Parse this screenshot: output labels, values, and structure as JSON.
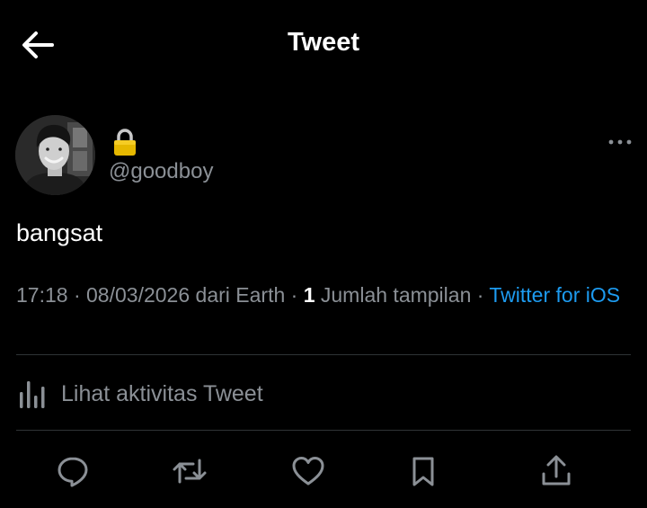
{
  "header": {
    "title": "Tweet",
    "back_icon": "arrow-left-icon"
  },
  "author": {
    "protected_icon": "lock-icon",
    "handle": "@goodboy",
    "more_icon": "more-horizontal-icon"
  },
  "tweet": {
    "text": "bangsat",
    "time": "17:18",
    "separator": " · ",
    "date": "08/03/2026",
    "location": " dari Earth",
    "views_count": "1",
    "views_label": " Jumlah tampilan",
    "source": "Twitter for iOS"
  },
  "activity": {
    "icon": "bar-chart-icon",
    "label": "Lihat aktivitas Tweet"
  },
  "actions": [
    {
      "icon": "reply-icon"
    },
    {
      "icon": "retweet-icon"
    },
    {
      "icon": "like-icon"
    },
    {
      "icon": "bookmark-icon"
    },
    {
      "icon": "share-icon"
    }
  ],
  "colors": {
    "background": "#000000",
    "text_primary": "#ffffff",
    "text_secondary": "#8b9096",
    "link": "#1d9bf0",
    "divider": "#2f3336",
    "lock": "#e6b800"
  }
}
